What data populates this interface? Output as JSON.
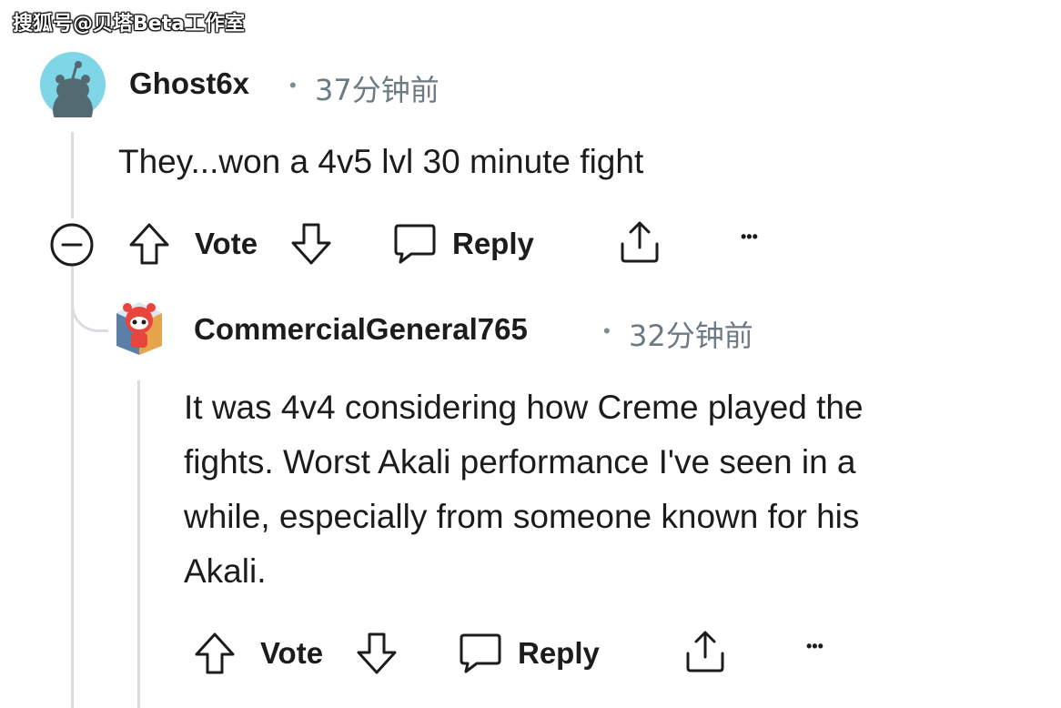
{
  "watermark": "搜狐号@贝塔Beta工作室",
  "comments": [
    {
      "username": "Ghost6x",
      "separator": "•",
      "time": "37分钟前",
      "body": "They...won a 4v5 lvl 30 minute fight",
      "avatar_icon": "reddit-snoo-avatar-icon",
      "actions": {
        "vote": "Vote",
        "reply": "Reply",
        "more": "•••"
      }
    },
    {
      "username": "CommercialGeneral765",
      "separator": "•",
      "time": "32分钟前",
      "body_lines": [
        "It was 4v4 considering how Creme played the",
        "fights. Worst Akali performance I've seen in a",
        "while, especially from someone known for his",
        "Akali."
      ],
      "avatar_icon": "snoo-character-avatar-icon",
      "actions": {
        "vote": "Vote",
        "reply": "Reply",
        "more": "•••"
      }
    }
  ],
  "colors": {
    "avatar1": "#7ed6e6",
    "avatar2_accent": "#e8453c",
    "thread_line": "#d9dde0"
  }
}
